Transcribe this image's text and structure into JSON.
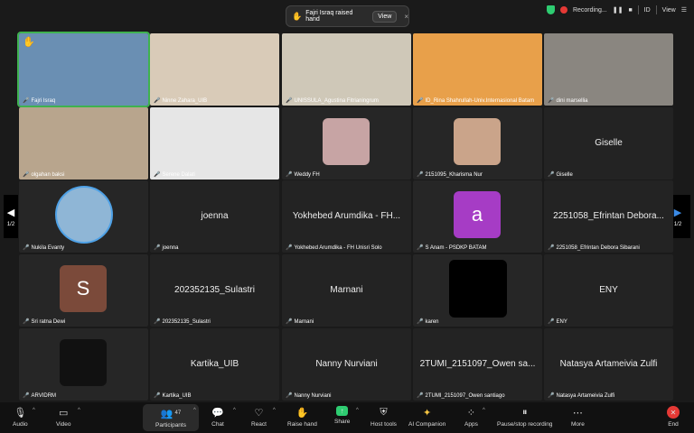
{
  "notification": {
    "hand": "✋",
    "text": "Fajri Israq raised hand",
    "view_label": "View",
    "close": "×"
  },
  "status": {
    "recording_label": "Recording...",
    "pause": "❚❚",
    "stop": "■",
    "id": "ID",
    "view": "View",
    "menu": "☰"
  },
  "nav": {
    "left_page": "1/2",
    "right_page": "1/2"
  },
  "participants": [
    {
      "name": "Fajri Israq",
      "big": "",
      "kind": "video",
      "bg": "#6a8fb3",
      "raised": true
    },
    {
      "name": "Ninne Zahara_UIB",
      "big": "",
      "kind": "video",
      "bg": "#d9cbb8"
    },
    {
      "name": "UNISSULA_Agustina Fitrianingrum",
      "big": "",
      "kind": "video",
      "bg": "#cfc8b8"
    },
    {
      "name": "ID_Rina Shahrullah-Univ.Internasional Batam",
      "big": "",
      "kind": "video",
      "bg": "#e8a04a"
    },
    {
      "name": "dini marsellia",
      "big": "",
      "kind": "video",
      "bg": "#8a8680"
    },
    {
      "name": "olgahan baksi",
      "big": "",
      "kind": "video",
      "bg": "#b8a58d"
    },
    {
      "name": "Serene Dalati",
      "big": "",
      "kind": "video",
      "bg": "#e6e6e6"
    },
    {
      "name": "Weddy FH",
      "big": "",
      "kind": "thumb",
      "bg": "#c7a4a4"
    },
    {
      "name": "2151095_Kharisma Nur",
      "big": "",
      "kind": "thumb",
      "bg": "#caa48a"
    },
    {
      "name": "Giselle",
      "big": "Giselle",
      "kind": "text"
    },
    {
      "name": "Nukila Evanty",
      "big": "",
      "kind": "thumbround",
      "bg": "#8fb6d6"
    },
    {
      "name": "joenna",
      "big": "joenna",
      "kind": "text"
    },
    {
      "name": "Yokhebed Arumdika - FH Unisri Solo",
      "big": "Yokhebed Arumdika - FH...",
      "kind": "text"
    },
    {
      "name": "S Anam - PSDKP BATAM",
      "big": "",
      "kind": "letter",
      "letter": "a",
      "bg": "#a63cc5"
    },
    {
      "name": "2251058_Efrintan Debora Sibarani",
      "big": "2251058_Efrintan Debora...",
      "kind": "text"
    },
    {
      "name": "Sri ratna Dewi",
      "big": "",
      "kind": "letter",
      "letter": "S",
      "bg": "#7b4a3a"
    },
    {
      "name": "202352135_Sulastri",
      "big": "202352135_Sulastri",
      "kind": "text"
    },
    {
      "name": "Marnani",
      "big": "Marnani",
      "kind": "text"
    },
    {
      "name": "karen",
      "big": "",
      "kind": "black",
      "bg": "#000000"
    },
    {
      "name": "ENY",
      "big": "ENY",
      "kind": "text"
    },
    {
      "name": "ARVIDRM",
      "big": "",
      "kind": "thumb",
      "bg": "#111111"
    },
    {
      "name": "Kartika_UIB",
      "big": "Kartika_UIB",
      "kind": "text"
    },
    {
      "name": "Nanny Nurviani",
      "big": "Nanny Nurviani",
      "kind": "text"
    },
    {
      "name": "2TUMI_2151097_Owen santiago",
      "big": "2TUMI_2151097_Owen sa...",
      "kind": "text"
    },
    {
      "name": "Natasya Artameivia Zulfi",
      "big": "Natasya Artameivia Zulfi",
      "kind": "text"
    }
  ],
  "toolbar": {
    "audio": "Audio",
    "video": "Video",
    "participants": "Participants",
    "participants_count": "47",
    "chat": "Chat",
    "react": "React",
    "raise_hand": "Raise hand",
    "share": "Share",
    "host_tools": "Host tools",
    "ai_companion": "AI Companion",
    "apps": "Apps",
    "pause_stop": "Pause/stop recording",
    "more": "More",
    "end": "End"
  },
  "colors": {
    "accent_green": "#3fb24f",
    "muted_red": "#e53935",
    "share_green": "#2ecc71"
  }
}
